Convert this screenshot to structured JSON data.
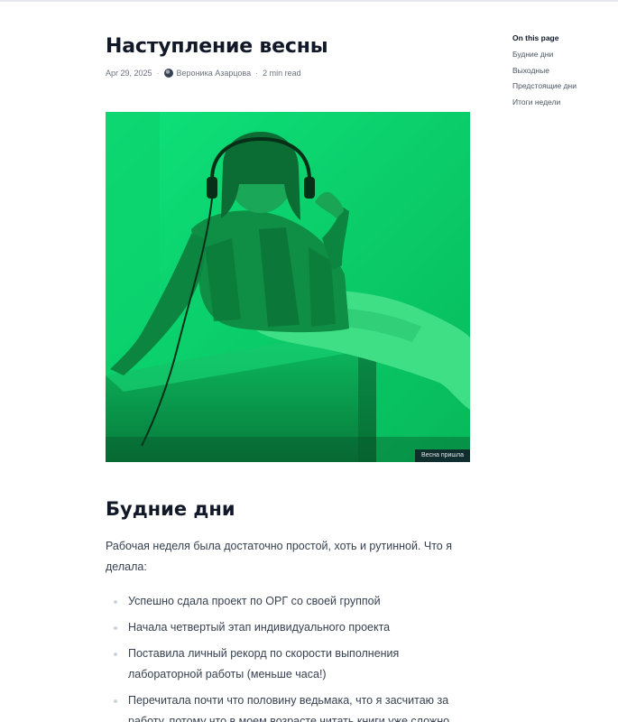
{
  "article": {
    "title": "Наступление весны",
    "meta": {
      "date": "Apr 29, 2025",
      "separator": "·",
      "author": "Вероника Азарцова",
      "read_time": "2 min read"
    },
    "hero_image": {
      "caption": "Весна пришла"
    },
    "sections": [
      {
        "heading": "Будние дни",
        "paragraph": "Рабочая неделя была достаточно простой, хоть и рутинной. Что я делала:",
        "items": [
          "Успешно сдала проект по ОРГ со своей группой",
          "Начала четвертый этап индивидуального проекта",
          "Поставила личный рекорд по скорости выполнения лабораторной работы (меньше часа!)",
          "Перечитала почти что половину ведьмака, что я засчитаю за работу, потому что в моем возрасте читать книги уже сложно"
        ]
      }
    ]
  },
  "toc": {
    "heading": "On this page",
    "links": [
      "Будние дни",
      "Выходные",
      "Предстоящие дни",
      "Итоги недели"
    ]
  },
  "colors": {
    "hero_green": "#08c760",
    "text_primary": "#111827",
    "text_body": "#374151",
    "text_muted": "#6b7280"
  }
}
